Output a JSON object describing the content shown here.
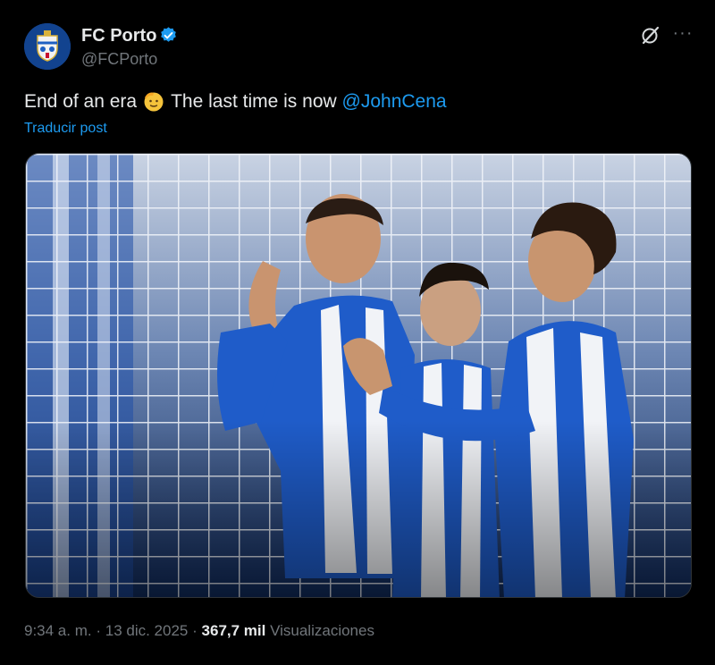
{
  "author": {
    "name": "FC Porto",
    "handle": "@FCPorto",
    "verified_icon": "verified-badge-icon",
    "avatar_icon": "fc-porto-crest-icon"
  },
  "actions": {
    "grok_icon": "grok-icon",
    "more_label": "···"
  },
  "post": {
    "text_before": "End of an era",
    "emoji": "saluting-face",
    "text_after": "The last time is now",
    "mention": "@JohnCena",
    "translate_label": "Traducir post"
  },
  "media": {
    "description_icon": "photo"
  },
  "meta": {
    "time": "9:34 a. m.",
    "separator": "·",
    "date": "13 dic. 2025",
    "views_count": "367,7 mil",
    "views_label": "Visualizaciones"
  },
  "colors": {
    "background": "#000000",
    "text": "#e7e9ea",
    "secondary": "#71767b",
    "accent": "#1d9bf0"
  }
}
